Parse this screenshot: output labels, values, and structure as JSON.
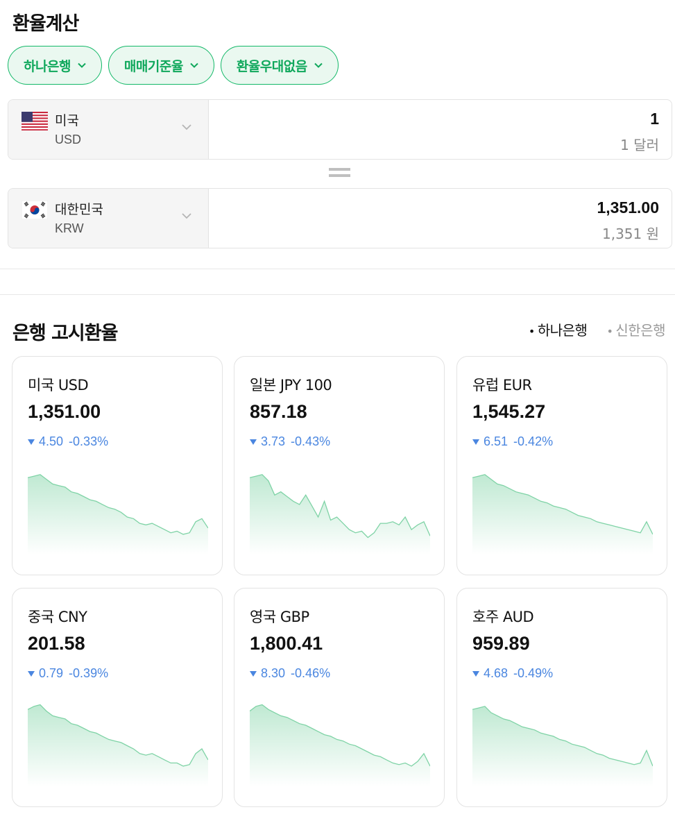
{
  "header": {
    "title": "환율계산"
  },
  "chips": [
    {
      "label": "하나은행"
    },
    {
      "label": "매매기준율"
    },
    {
      "label": "환율우대없음"
    }
  ],
  "converter": {
    "from": {
      "country": "미국",
      "code": "USD",
      "amount": "1",
      "amount_text": "1 달러"
    },
    "to": {
      "country": "대한민국",
      "code": "KRW",
      "amount": "1,351.00",
      "amount_text": "1,351 원"
    }
  },
  "rates_section": {
    "title": "은행 고시환율",
    "banks": [
      {
        "label": "하나은행",
        "active": true
      },
      {
        "label": "신한은행",
        "active": false
      }
    ]
  },
  "cards": [
    {
      "label": "미국 USD",
      "rate": "1,351.00",
      "change": "4.50",
      "change_pct": "-0.33%",
      "trend": [
        80,
        82,
        84,
        78,
        72,
        70,
        68,
        62,
        60,
        56,
        52,
        50,
        46,
        42,
        40,
        36,
        30,
        28,
        22,
        20,
        22,
        18,
        14,
        10,
        12,
        8,
        10,
        24,
        28,
        16
      ]
    },
    {
      "label": "일본 JPY 100",
      "rate": "857.18",
      "change": "3.73",
      "change_pct": "-0.43%",
      "trend": [
        80,
        82,
        84,
        76,
        58,
        62,
        56,
        50,
        46,
        58,
        44,
        30,
        50,
        26,
        30,
        22,
        14,
        10,
        12,
        4,
        10,
        22,
        22,
        24,
        20,
        30,
        14,
        20,
        24,
        6
      ]
    },
    {
      "label": "유럽 EUR",
      "rate": "1,545.27",
      "change": "6.51",
      "change_pct": "-0.42%",
      "trend": [
        80,
        82,
        84,
        78,
        72,
        70,
        66,
        62,
        60,
        58,
        54,
        50,
        48,
        44,
        42,
        40,
        36,
        32,
        30,
        28,
        24,
        22,
        20,
        18,
        16,
        14,
        12,
        10,
        24,
        8
      ]
    },
    {
      "label": "중국 CNY",
      "rate": "201.58",
      "change": "0.79",
      "change_pct": "-0.39%",
      "trend": [
        80,
        84,
        86,
        78,
        72,
        70,
        68,
        62,
        60,
        56,
        52,
        50,
        46,
        42,
        40,
        38,
        34,
        30,
        24,
        22,
        24,
        20,
        16,
        12,
        12,
        8,
        10,
        24,
        30,
        16
      ]
    },
    {
      "label": "영국 GBP",
      "rate": "1,800.41",
      "change": "8.30",
      "change_pct": "-0.46%",
      "trend": [
        78,
        84,
        86,
        80,
        76,
        72,
        70,
        66,
        62,
        60,
        56,
        52,
        48,
        46,
        42,
        40,
        36,
        34,
        30,
        26,
        22,
        20,
        16,
        12,
        10,
        12,
        8,
        14,
        24,
        8
      ]
    },
    {
      "label": "호주 AUD",
      "rate": "959.89",
      "change": "4.68",
      "change_pct": "-0.49%",
      "trend": [
        80,
        82,
        84,
        76,
        72,
        68,
        66,
        62,
        58,
        56,
        54,
        50,
        48,
        46,
        42,
        40,
        36,
        34,
        32,
        28,
        24,
        22,
        18,
        16,
        14,
        12,
        10,
        12,
        28,
        8
      ]
    }
  ],
  "colors": {
    "accent": "#12b867",
    "down": "#4a86e0",
    "spark": "#7fd3a6"
  }
}
